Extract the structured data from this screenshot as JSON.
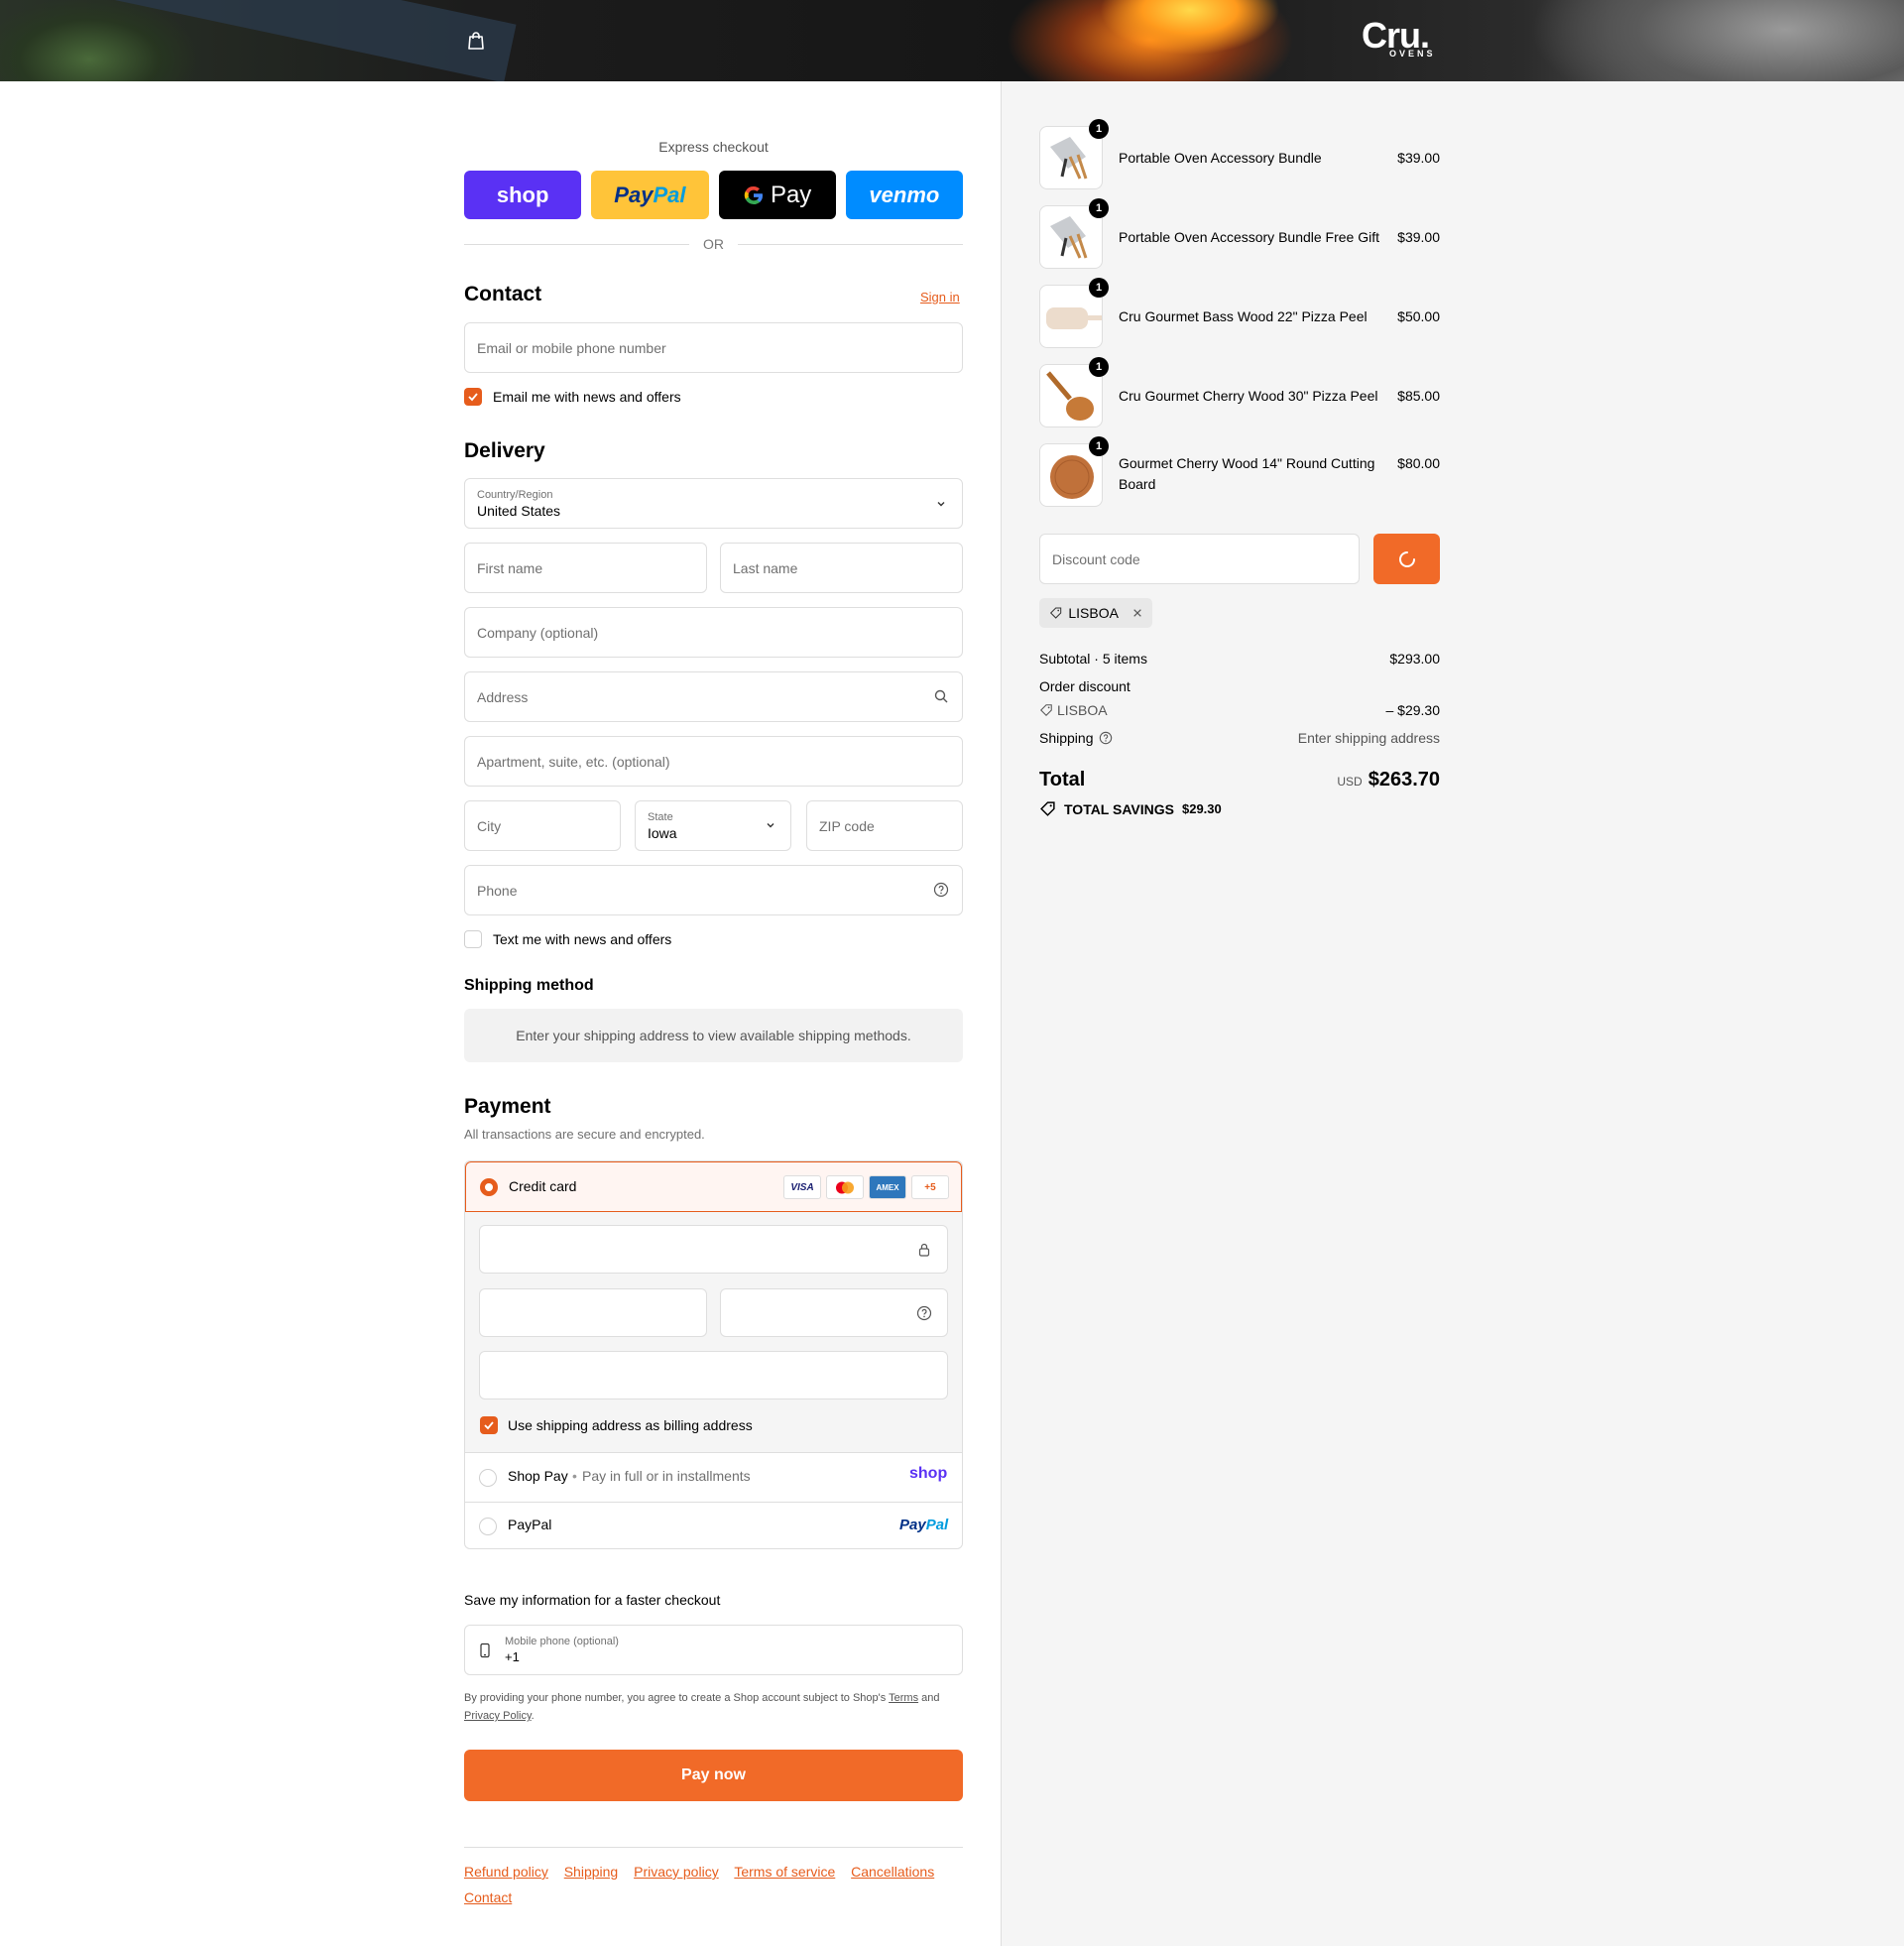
{
  "header": {
    "brand": "Cru.",
    "brand_sub": "OVENS"
  },
  "express": {
    "title": "Express checkout",
    "shop_label": "shop",
    "paypal_a": "Pay",
    "paypal_b": "Pal",
    "gpay_label": "Pay",
    "venmo_label": "venmo",
    "or_label": "OR"
  },
  "contact": {
    "heading": "Contact",
    "signin": "Sign in",
    "email_placeholder": "Email or mobile phone number",
    "news_label": "Email me with news and offers",
    "news_checked": true
  },
  "delivery": {
    "heading": "Delivery",
    "country_label": "Country/Region",
    "country_value": "United States",
    "first_name": "First name",
    "last_name": "Last name",
    "company": "Company (optional)",
    "address": "Address",
    "apartment": "Apartment, suite, etc. (optional)",
    "city": "City",
    "state_label": "State",
    "state_value": "Iowa",
    "zip": "ZIP code",
    "phone": "Phone",
    "text_label": "Text me with news and offers",
    "text_checked": false
  },
  "shipping_method": {
    "heading": "Shipping method",
    "message": "Enter your shipping address to view available shipping methods."
  },
  "payment": {
    "heading": "Payment",
    "subtitle": "All transactions are secure and encrypted.",
    "credit_card_label": "Credit card",
    "card_brands": [
      "VISA",
      "MC",
      "AMEX",
      "+5"
    ],
    "billing_label": "Use shipping address as billing address",
    "billing_checked": true,
    "shop_pay_label": "Shop Pay",
    "shop_pay_sub": "Pay in full or in installments",
    "shop_pay_logo": "shop",
    "paypal_label": "PayPal",
    "paypal_logo_a": "Pay",
    "paypal_logo_b": "Pal"
  },
  "save_info": {
    "heading": "Save my information for a faster checkout",
    "mobile_label": "Mobile phone (optional)",
    "mobile_value": "+1",
    "legal_a": "By providing your phone number, you agree to create a Shop account subject to Shop's",
    "terms": "Terms",
    "legal_b": "and",
    "privacy": "Privacy Policy",
    "legal_end": "."
  },
  "pay_now": "Pay now",
  "footer_links": [
    "Refund policy",
    "Shipping",
    "Privacy policy",
    "Terms of service",
    "Cancellations",
    "Contact"
  ],
  "cart": {
    "items": [
      {
        "name": "Portable Oven Accessory Bundle",
        "price": "$39.00",
        "qty": "1"
      },
      {
        "name": "Portable Oven Accessory Bundle Free Gift",
        "price": "$39.00",
        "qty": "1"
      },
      {
        "name": "Cru Gourmet Bass Wood 22\" Pizza Peel",
        "price": "$50.00",
        "qty": "1"
      },
      {
        "name": "Cru Gourmet Cherry Wood 30\" Pizza Peel",
        "price": "$85.00",
        "qty": "1"
      },
      {
        "name": "Gourmet Cherry Wood 14\" Round Cutting Board",
        "price": "$80.00",
        "qty": "1"
      }
    ],
    "discount_placeholder": "Discount code",
    "applied_code": "LISBOA",
    "subtotal_label": "Subtotal · 5 items",
    "subtotal": "$293.00",
    "order_discount_label": "Order discount",
    "discount_code": "LISBOA",
    "discount_amount": "– $29.30",
    "shipping_label": "Shipping",
    "shipping_value": "Enter shipping address",
    "total_label": "Total",
    "currency": "USD",
    "total": "$263.70",
    "savings_label": "TOTAL SAVINGS",
    "savings": "$29.30"
  },
  "colors": {
    "accent": "#e65c1c",
    "shop": "#5a31f4",
    "paypal": "#ffc439",
    "venmo": "#008cff"
  }
}
